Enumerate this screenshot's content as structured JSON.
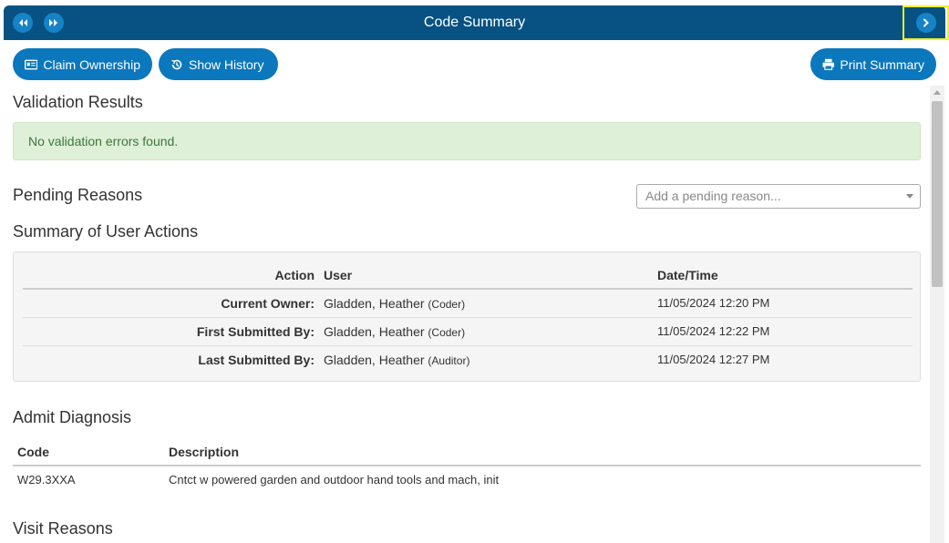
{
  "header": {
    "title": "Code Summary",
    "icons": {
      "prev": "double-chevron-left-icon",
      "next": "double-chevron-right-icon",
      "collapse": "chevron-right-icon"
    }
  },
  "toolbar": {
    "claim_label": "Claim Ownership",
    "history_label": "Show History",
    "print_label": "Print Summary"
  },
  "validation": {
    "heading": "Validation Results",
    "message": "No validation errors found."
  },
  "pending": {
    "heading": "Pending Reasons",
    "placeholder": "Add a pending reason..."
  },
  "user_actions": {
    "heading": "Summary of User Actions",
    "columns": [
      "Action",
      "User",
      "Date/Time"
    ],
    "rows": [
      {
        "action": "Current Owner:",
        "user": "Gladden, Heather",
        "role": "(Coder)",
        "datetime": "11/05/2024 12:20 PM"
      },
      {
        "action": "First Submitted By:",
        "user": "Gladden, Heather",
        "role": "(Coder)",
        "datetime": "11/05/2024 12:22 PM"
      },
      {
        "action": "Last Submitted By:",
        "user": "Gladden, Heather",
        "role": "(Auditor)",
        "datetime": "11/05/2024 12:27 PM"
      }
    ]
  },
  "admit_diagnosis": {
    "heading": "Admit Diagnosis",
    "columns": [
      "Code",
      "Description"
    ],
    "rows": [
      {
        "code": "W29.3XXA",
        "description": "Cntct w powered garden and outdoor hand tools and mach, init"
      }
    ]
  },
  "visit_reasons": {
    "heading": "Visit Reasons"
  },
  "colors": {
    "header_bg": "#075283",
    "button_bg": "#0b77bd",
    "alert_bg": "#dff0d8",
    "alert_text": "#3c763d"
  }
}
